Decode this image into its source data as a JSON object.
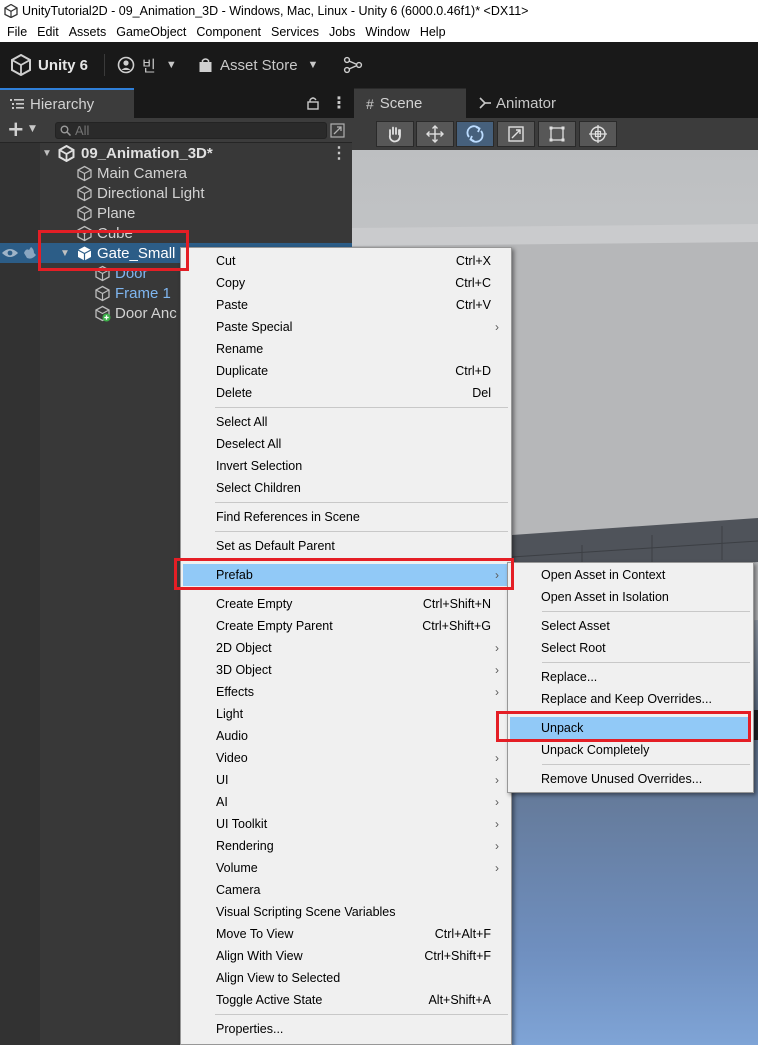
{
  "window": {
    "title": "UnityTutorial2D - 09_Animation_3D - Windows, Mac, Linux - Unity 6 (6000.0.46f1)* <DX11>"
  },
  "menubar": [
    "File",
    "Edit",
    "Assets",
    "GameObject",
    "Component",
    "Services",
    "Jobs",
    "Window",
    "Help"
  ],
  "toolbar": {
    "unity_label": "Unity 6",
    "account_label": "빈",
    "asset_store_label": "Asset Store"
  },
  "hierarchy": {
    "tab_label": "Hierarchy",
    "search_placeholder": "All",
    "scene_name": "09_Animation_3D*",
    "items": [
      {
        "label": "Main Camera"
      },
      {
        "label": "Directional Light"
      },
      {
        "label": "Plane"
      },
      {
        "label": "Cube"
      },
      {
        "label": "Gate_Small"
      },
      {
        "label": "Door"
      },
      {
        "label": "Frame 1"
      },
      {
        "label": "Door Anc"
      }
    ]
  },
  "scene": {
    "scene_tab": "Scene",
    "animator_tab": "Animator"
  },
  "context_menu": {
    "groups": [
      [
        {
          "label": "Cut",
          "shortcut": "Ctrl+X"
        },
        {
          "label": "Copy",
          "shortcut": "Ctrl+C"
        },
        {
          "label": "Paste",
          "shortcut": "Ctrl+V"
        },
        {
          "label": "Paste Special",
          "shortcut": ""
        },
        {
          "label": "Rename",
          "shortcut": ""
        },
        {
          "label": "Duplicate",
          "shortcut": "Ctrl+D"
        },
        {
          "label": "Delete",
          "shortcut": "Del"
        }
      ],
      [
        {
          "label": "Select All",
          "shortcut": ""
        },
        {
          "label": "Deselect All",
          "shortcut": ""
        },
        {
          "label": "Invert Selection",
          "shortcut": ""
        },
        {
          "label": "Select Children",
          "shortcut": ""
        }
      ],
      [
        {
          "label": "Find References in Scene",
          "shortcut": ""
        }
      ],
      [
        {
          "label": "Set as Default Parent",
          "shortcut": ""
        }
      ],
      [
        {
          "label": "Prefab",
          "shortcut": ""
        }
      ],
      [
        {
          "label": "Create Empty",
          "shortcut": "Ctrl+Shift+N"
        },
        {
          "label": "Create Empty Parent",
          "shortcut": "Ctrl+Shift+G"
        },
        {
          "label": "2D Object",
          "shortcut": ""
        },
        {
          "label": "3D Object",
          "shortcut": ""
        },
        {
          "label": "Effects",
          "shortcut": ""
        },
        {
          "label": "Light",
          "shortcut": ""
        },
        {
          "label": "Audio",
          "shortcut": ""
        },
        {
          "label": "Video",
          "shortcut": ""
        },
        {
          "label": "UI",
          "shortcut": ""
        },
        {
          "label": "AI",
          "shortcut": ""
        },
        {
          "label": "UI Toolkit",
          "shortcut": ""
        },
        {
          "label": "Rendering",
          "shortcut": ""
        },
        {
          "label": "Volume",
          "shortcut": ""
        },
        {
          "label": "Camera",
          "shortcut": ""
        },
        {
          "label": "Visual Scripting Scene Variables",
          "shortcut": ""
        },
        {
          "label": "Move To View",
          "shortcut": "Ctrl+Alt+F"
        },
        {
          "label": "Align With View",
          "shortcut": "Ctrl+Shift+F"
        },
        {
          "label": "Align View to Selected",
          "shortcut": ""
        },
        {
          "label": "Toggle Active State",
          "shortcut": "Alt+Shift+A"
        }
      ],
      [
        {
          "label": "Properties...",
          "shortcut": ""
        }
      ]
    ]
  },
  "prefab_submenu": {
    "groups": [
      [
        {
          "label": "Open Asset in Context"
        },
        {
          "label": "Open Asset in Isolation"
        }
      ],
      [
        {
          "label": "Select Asset"
        },
        {
          "label": "Select Root"
        }
      ],
      [
        {
          "label": "Replace..."
        },
        {
          "label": "Replace and Keep Overrides..."
        }
      ],
      [
        {
          "label": "Unpack"
        },
        {
          "label": "Unpack Completely"
        }
      ],
      [
        {
          "label": "Remove Unused Overrides..."
        }
      ]
    ]
  },
  "colors": {
    "highlight": "#91c9f7",
    "annotation_red": "#e41e25",
    "selected_row": "#2c5d87",
    "prefab_blue": "#7fb6f0"
  }
}
